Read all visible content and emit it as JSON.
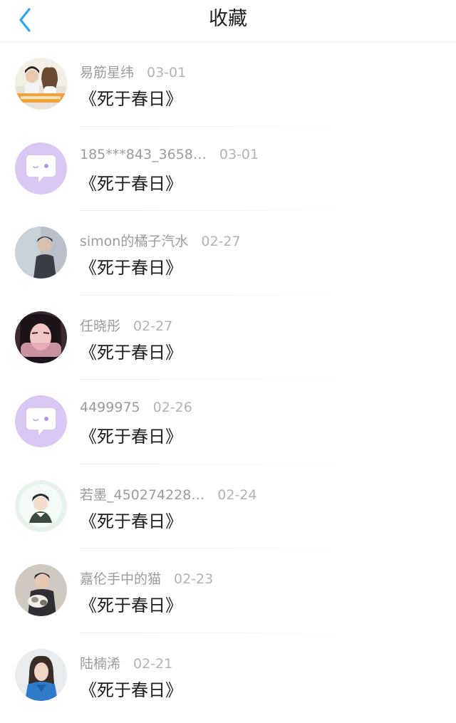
{
  "header": {
    "title": "收藏",
    "back_icon": "chevron-left-icon",
    "accent_color": "#2fa4f0"
  },
  "items": [
    {
      "username": "易筋星纬",
      "date": "03-01",
      "content": "《死于春日》",
      "avatar": "photo-couple-avatar"
    },
    {
      "username": "185***843_3658…",
      "date": "03-01",
      "content": "《死于春日》",
      "avatar": "default-chat-bubble-avatar"
    },
    {
      "username": "simon的橘子汽水",
      "date": "02-27",
      "content": "《死于春日》",
      "avatar": "photo-avatar"
    },
    {
      "username": "任晓彤",
      "date": "02-27",
      "content": "《死于春日》",
      "avatar": "photo-avatar"
    },
    {
      "username": "4499975",
      "date": "02-26",
      "content": "《死于春日》",
      "avatar": "default-chat-bubble-avatar"
    },
    {
      "username": "若墨_450274228…",
      "date": "02-24",
      "content": "《死于春日》",
      "avatar": "photo-avatar"
    },
    {
      "username": "嘉伦手中的猫",
      "date": "02-23",
      "content": "《死于春日》",
      "avatar": "photo-avatar"
    },
    {
      "username": "陆楠浠",
      "date": "02-21",
      "content": "《死于春日》",
      "avatar": "photo-avatar"
    }
  ]
}
